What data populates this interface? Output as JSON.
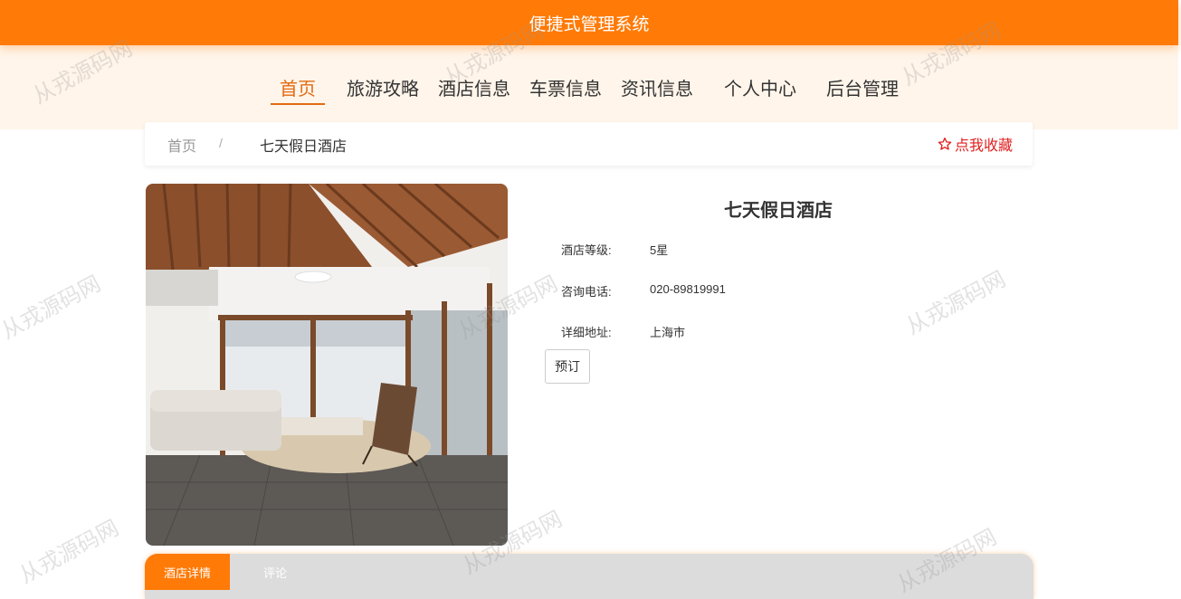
{
  "header": {
    "title": "便捷式管理系统"
  },
  "nav": {
    "items": [
      "首页",
      "旅游攻略",
      "酒店信息",
      "车票信息",
      "资讯信息",
      "个人中心",
      "后台管理"
    ],
    "active_index": 0
  },
  "breadcrumb": {
    "home": "首页",
    "separator": "/",
    "current": "七天假日酒店"
  },
  "favorite": {
    "label": "点我收藏",
    "icon": "star-outline-icon"
  },
  "hotel": {
    "name": "七天假日酒店",
    "fields": [
      {
        "label": "酒店等级:",
        "value": "5星"
      },
      {
        "label": "咨询电话:",
        "value": "020-89819991"
      },
      {
        "label": "详细地址:",
        "value": "上海市"
      }
    ],
    "book_label": "预订"
  },
  "tabs": [
    "酒店详情",
    "评论"
  ],
  "watermark": "从戎源码网",
  "colors": {
    "accent": "#ff7a06",
    "nav_band": "#fff5ea",
    "favorite": "#e0211f"
  }
}
